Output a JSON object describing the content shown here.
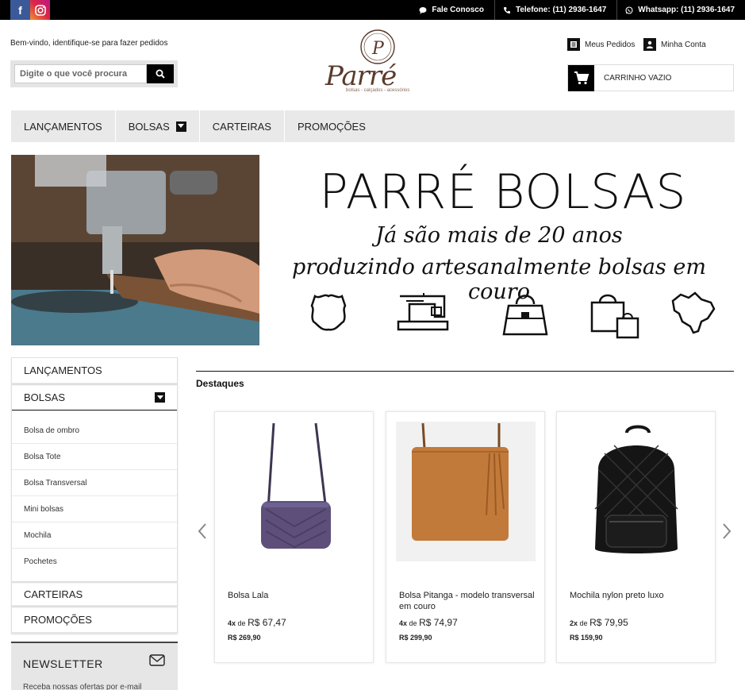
{
  "topbar": {
    "social": [
      {
        "name": "facebook",
        "glyph": "f"
      },
      {
        "name": "instagram",
        "glyph": "◎"
      }
    ],
    "links": [
      {
        "label": "Fale Conosco",
        "icon": "chat-icon"
      },
      {
        "label": "Telefone: (11) 2936-1647",
        "icon": "phone-icon"
      },
      {
        "label": "Whatsapp: (11) 2936-1647",
        "icon": "whatsapp-icon"
      }
    ]
  },
  "header": {
    "welcome": "Bem-vindo, identifique-se para fazer pedidos",
    "search_placeholder": "Digite o que você procura",
    "logo_text": "Parré",
    "logo_tagline": "bolsas - calçados - acessórios",
    "orders": "Meus Pedidos",
    "account": "Minha Conta",
    "cart": "CARRINHO VAZIO"
  },
  "nav": {
    "items": [
      {
        "label": "LANÇAMENTOS"
      },
      {
        "label": "BOLSAS"
      },
      {
        "label": "CARTEIRAS"
      },
      {
        "label": "PROMOÇÕES"
      }
    ]
  },
  "banner": {
    "title": "PARRÉ BOLSAS",
    "line1": "Já são mais de 20 anos",
    "line2": "produzindo artesanalmente bolsas em couro",
    "icons": [
      "leather-icon",
      "sewing-machine-icon",
      "handbag-icon",
      "shopping-bag-icon",
      "brazil-map-icon"
    ]
  },
  "sidebar": {
    "cat1": "LANÇAMENTOS",
    "cat2": "BOLSAS",
    "subs": [
      "Bolsa de ombro",
      "Bolsa Tote",
      "Bolsa Transversal",
      "Mini bolsas",
      "Mochila",
      "Pochetes"
    ],
    "cat3": "CARTEIRAS",
    "cat4": "PROMOÇÕES",
    "newsletter_title": "NEWSLETTER",
    "newsletter_desc": "Receba nossas ofertas por e-mail"
  },
  "featured": {
    "title": "Destaques",
    "products": [
      {
        "name": "Bolsa Lala",
        "installments": "4x",
        "de": "de",
        "installment_value": "R$ 67,47",
        "price": "R$ 269,90",
        "color": "#5d4f7a"
      },
      {
        "name": "Bolsa Pitanga - modelo transversal em couro",
        "installments": "4x",
        "de": "de",
        "installment_value": "R$ 74,97",
        "price": "R$ 299,90",
        "color": "#c27a3a"
      },
      {
        "name": "Mochila nylon preto luxo",
        "installments": "2x",
        "de": "de",
        "installment_value": "R$ 79,95",
        "price": "R$ 159,90",
        "color": "#151515"
      }
    ]
  }
}
